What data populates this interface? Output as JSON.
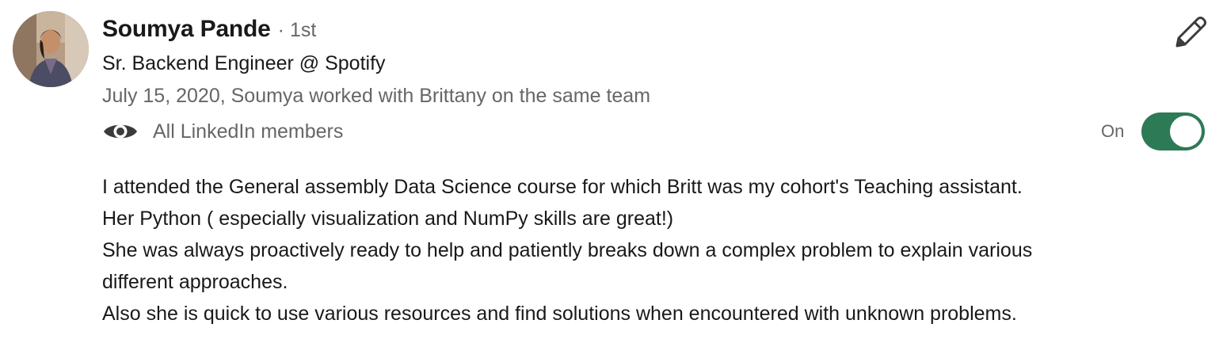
{
  "recommender": {
    "name": "Soumya Pande",
    "degree": "· 1st",
    "headline": "Sr. Backend Engineer @ Spotify",
    "meta": "July 15, 2020, Soumya worked with Brittany on the same team"
  },
  "visibility": {
    "icon": "eye-icon",
    "label": "All LinkedIn members"
  },
  "toggle": {
    "label": "On",
    "state": "on",
    "color": "#2d7a56"
  },
  "edit": {
    "icon": "pencil-icon"
  },
  "recommendation": {
    "lines": [
      "I attended the General assembly Data Science course for which Britt was my cohort's Teaching assistant.",
      "Her Python ( especially visualization and NumPy skills are great!)",
      "She was always proactively ready to help and patiently breaks down a complex problem to explain various",
      "different approaches.",
      "Also she is quick to use various resources and find solutions when encountered with unknown problems."
    ]
  }
}
